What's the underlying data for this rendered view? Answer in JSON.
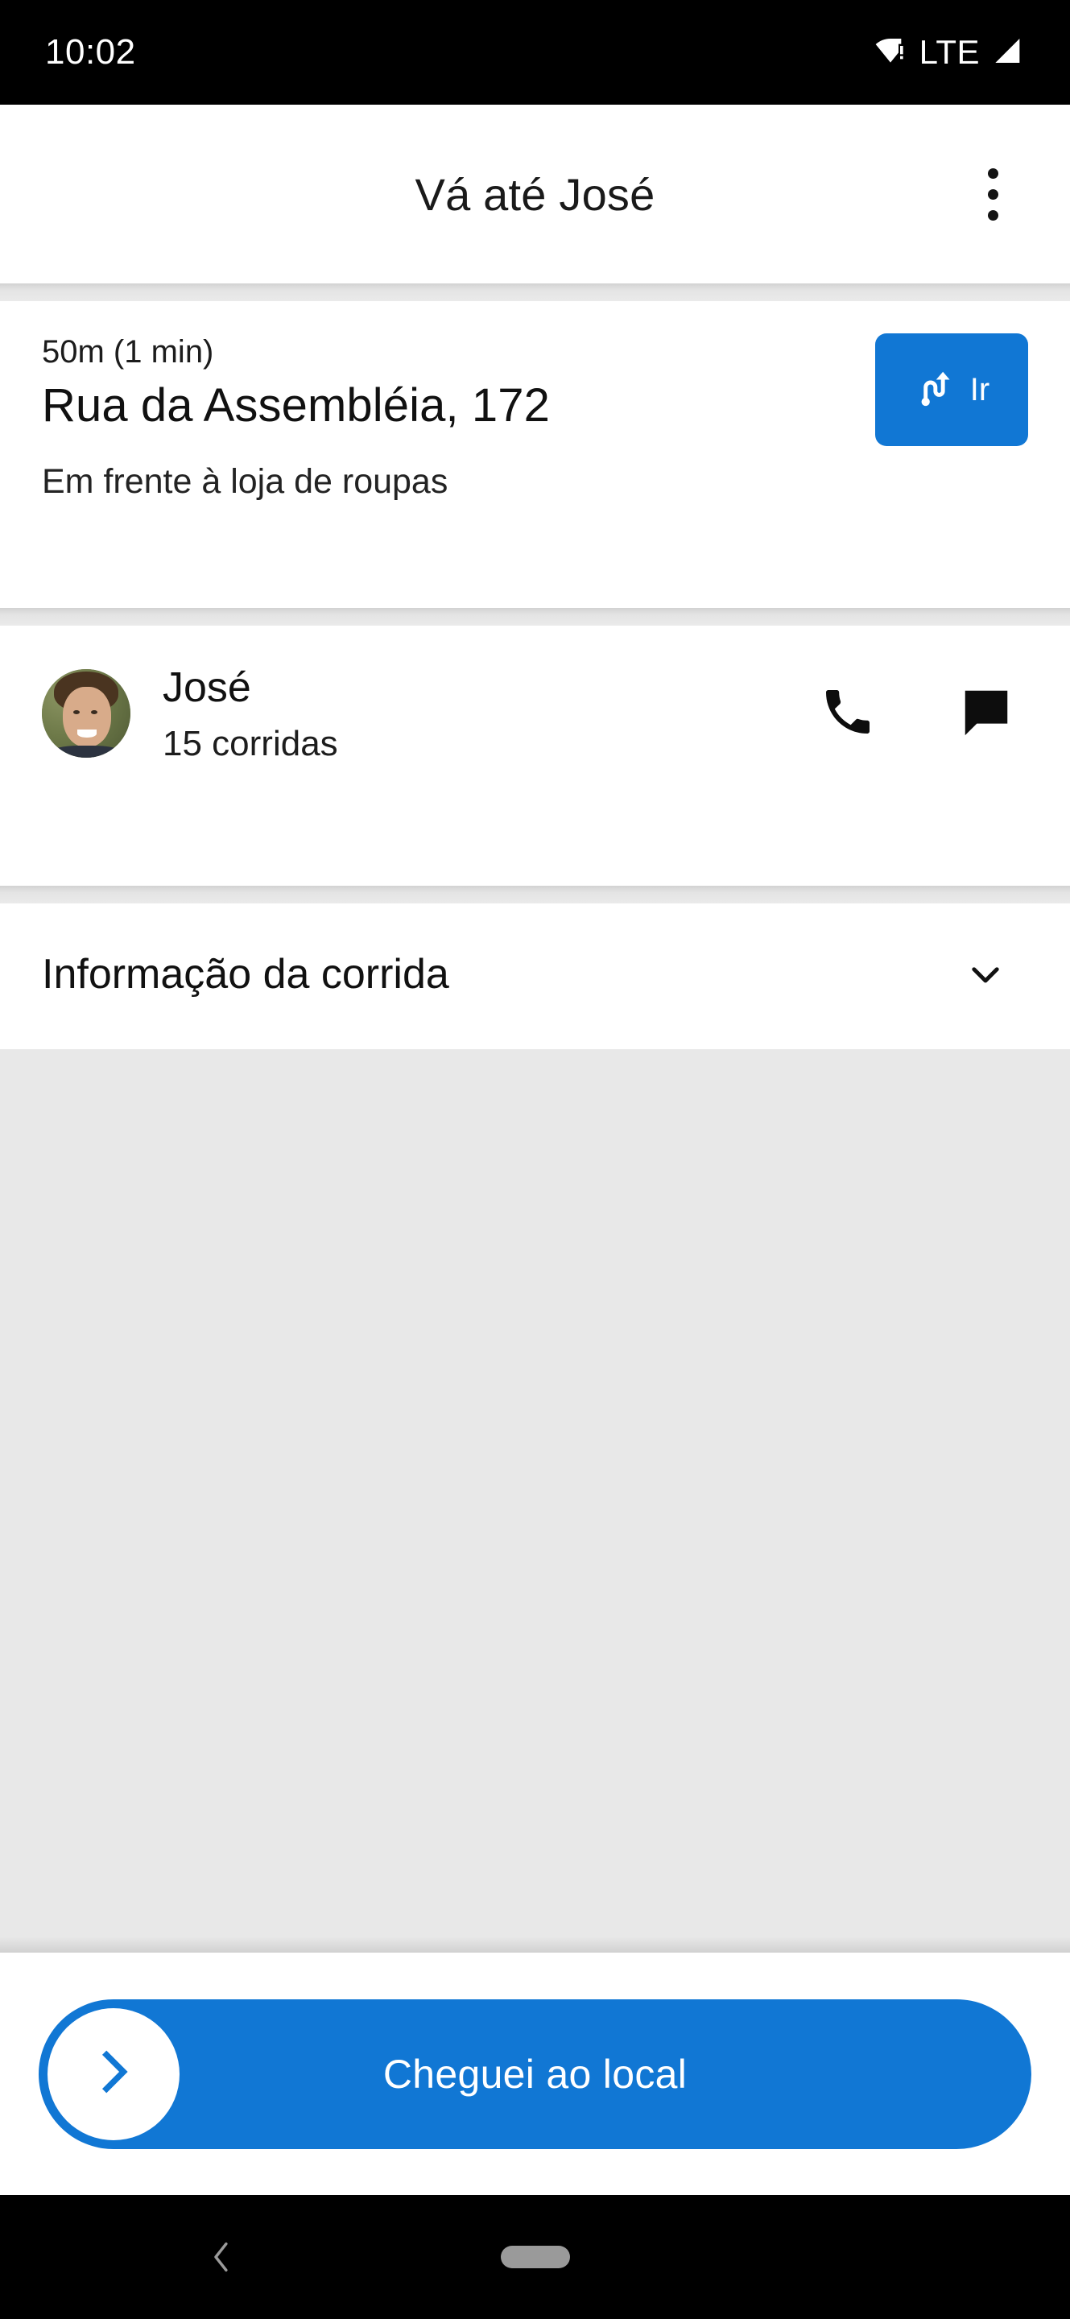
{
  "status_bar": {
    "time": "10:02",
    "network_label": "LTE",
    "wifi_icon": "wifi-exclamation-icon",
    "signal_icon": "cellular-signal-icon"
  },
  "app_bar": {
    "title": "Vá até José",
    "overflow_icon": "more-vert-icon"
  },
  "address_card": {
    "eta": "50m (1 min)",
    "street": "Rua da Assembléia, 172",
    "note": "Em frente à loja de roupas",
    "go_button": {
      "label": "Ir",
      "icon": "navigation-route-icon",
      "color": "#1177d4"
    }
  },
  "driver_card": {
    "avatar_icon": "user-avatar-photo",
    "name": "José",
    "rides": "15 corridas",
    "actions": [
      {
        "name": "call-button",
        "icon": "phone-icon"
      },
      {
        "name": "message-button",
        "icon": "chat-bubble-icon"
      }
    ]
  },
  "ride_info": {
    "title": "Informação da corrida",
    "expand_icon": "chevron-down-icon"
  },
  "map": {
    "placeholder_color": "#e8e8e8"
  },
  "bottom_action": {
    "label": "Cheguei ao local",
    "knob_icon": "chevron-right-icon",
    "color": "#1177d4"
  },
  "nav_bar": {
    "back_icon": "nav-back-icon",
    "home_icon": "nav-home-pill"
  }
}
